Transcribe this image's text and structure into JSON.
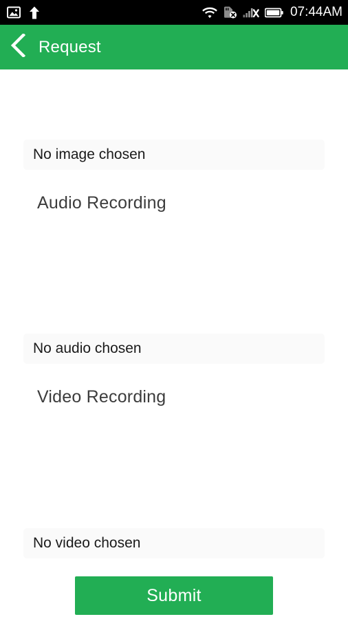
{
  "status_bar": {
    "background_color": "#000000",
    "time": "07:44AM",
    "left_icons": [
      {
        "name": "image-icon",
        "glyph": "image"
      },
      {
        "name": "upload-arrow-icon",
        "glyph": "arrow-up"
      }
    ],
    "right_icons": [
      {
        "name": "wifi-icon",
        "glyph": "wifi"
      },
      {
        "name": "sd-card-off-icon",
        "glyph": "sd-card-x"
      },
      {
        "name": "signal-off-icon",
        "glyph": "signal-bars-x"
      },
      {
        "name": "battery-icon",
        "glyph": "battery-full"
      }
    ]
  },
  "app_bar": {
    "background_color": "#22ae54",
    "title": "Request",
    "back_icon": "chevron-left-icon"
  },
  "theme": {
    "accent_color": "#22ae54",
    "field_background": "#fafafa",
    "page_background": "#ffffff"
  },
  "form": {
    "image_section": {
      "status_text": "No image chosen"
    },
    "audio_section": {
      "label": "Audio Recording",
      "status_text": "No audio chosen"
    },
    "video_section": {
      "label": "Video Recording",
      "status_text": "No video chosen"
    }
  },
  "actions": {
    "submit_label": "Submit"
  }
}
